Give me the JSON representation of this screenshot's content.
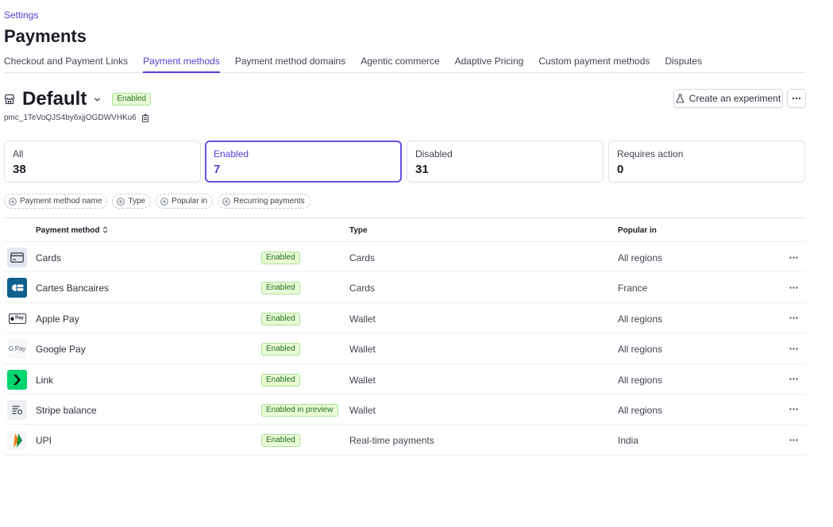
{
  "breadcrumb": "Settings",
  "page_title": "Payments",
  "tabs": [
    {
      "label": "Checkout and Payment Links",
      "active": false
    },
    {
      "label": "Payment methods",
      "active": true
    },
    {
      "label": "Payment method domains",
      "active": false
    },
    {
      "label": "Agentic commerce",
      "active": false
    },
    {
      "label": "Adaptive Pricing",
      "active": false
    },
    {
      "label": "Custom payment methods",
      "active": false
    },
    {
      "label": "Disputes",
      "active": false
    }
  ],
  "config": {
    "name": "Default",
    "status": "Enabled",
    "id": "pmc_1TeVoQJS4by6xjjOGDWVHKu6",
    "store_icon": "store-icon",
    "dropdown_icon": "chevron-down-icon"
  },
  "actions": {
    "experiment_label": "Create an experiment",
    "experiment_icon": "flask-icon",
    "more_icon": "more-horizontal-icon"
  },
  "stats": [
    {
      "label": "All",
      "value": "38"
    },
    {
      "label": "Enabled",
      "value": "7"
    },
    {
      "label": "Disabled",
      "value": "31"
    },
    {
      "label": "Requires action",
      "value": "0"
    }
  ],
  "filters": [
    "Payment method name",
    "Type",
    "Popular in",
    "Recurring payments"
  ],
  "table": {
    "headers": {
      "method": "Payment method",
      "type": "Type",
      "popular": "Popular in"
    },
    "rows": [
      {
        "logo": "card-icon",
        "name": "Cards",
        "status": "Enabled",
        "type": "Cards",
        "popular": "All regions"
      },
      {
        "logo": "cartes-bancaires-logo",
        "name": "Cartes Bancaires",
        "status": "Enabled",
        "type": "Cards",
        "popular": "France"
      },
      {
        "logo": "apple-pay-logo",
        "logo_text": "Pay",
        "name": "Apple Pay",
        "status": "Enabled",
        "type": "Wallet",
        "popular": "All regions"
      },
      {
        "logo": "google-pay-logo",
        "logo_text": "G Pay",
        "name": "Google Pay",
        "status": "Enabled",
        "type": "Wallet",
        "popular": "All regions"
      },
      {
        "logo": "link-logo",
        "name": "Link",
        "status": "Enabled",
        "type": "Wallet",
        "popular": "All regions"
      },
      {
        "logo": "stripe-balance-icon",
        "name": "Stripe balance",
        "status": "Enabled in preview",
        "type": "Wallet",
        "popular": "All regions"
      },
      {
        "logo": "upi-logo",
        "name": "UPI",
        "status": "Enabled",
        "type": "Real-time payments",
        "popular": "India"
      }
    ]
  },
  "colors": {
    "accent": "#5d3bd6",
    "badge_bg": "#e9fbd7",
    "badge_text": "#216e1f",
    "cartes_bancaires": "#0f5f8f",
    "link_green": "#00d66f"
  }
}
